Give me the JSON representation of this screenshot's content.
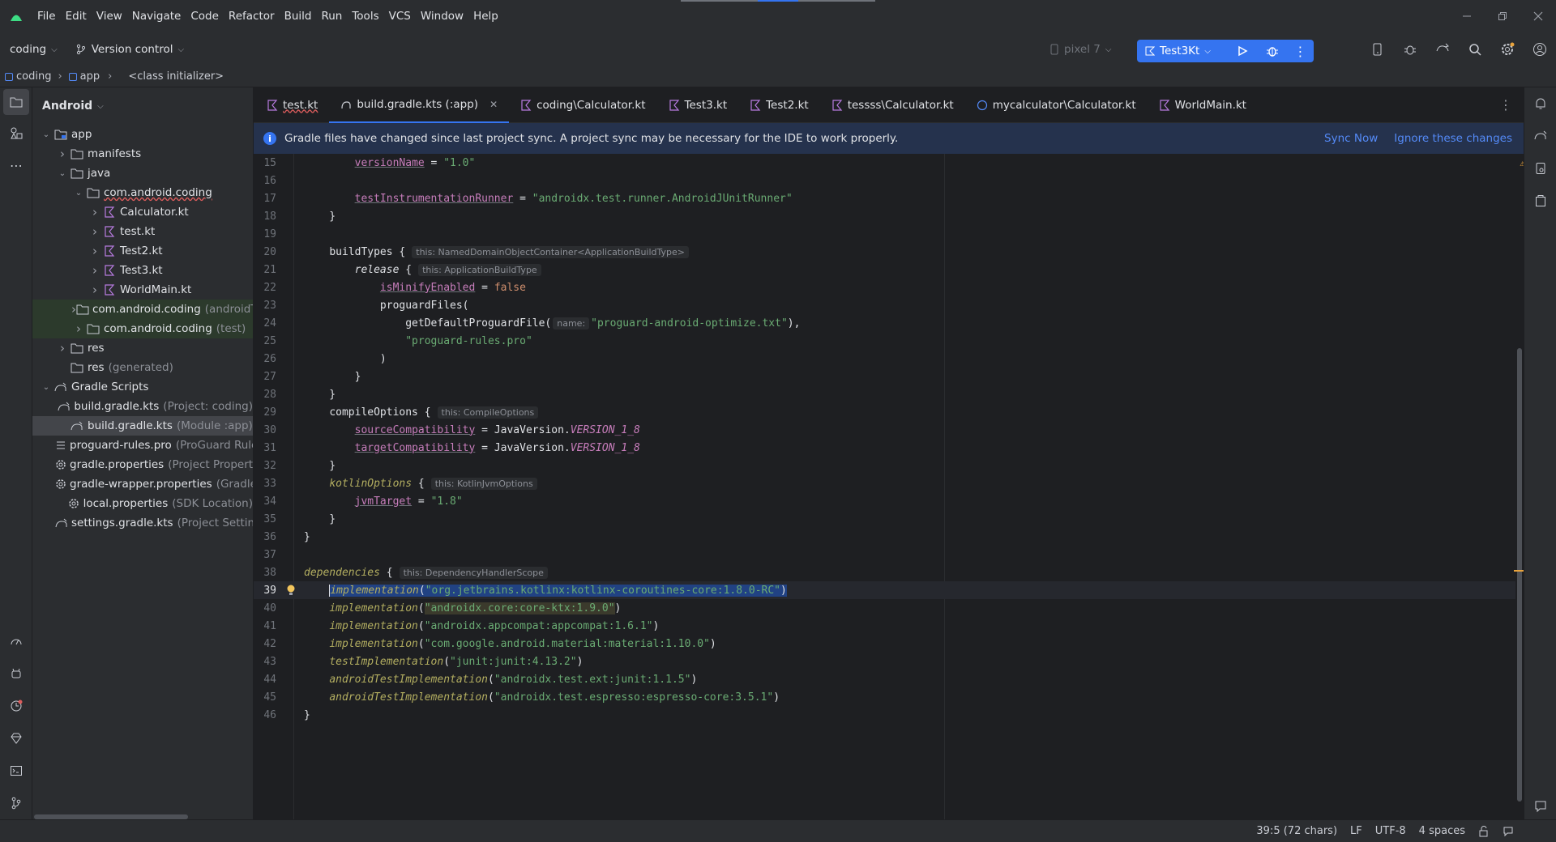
{
  "menu": [
    "File",
    "Edit",
    "View",
    "Navigate",
    "Code",
    "Refactor",
    "Build",
    "Run",
    "Tools",
    "VCS",
    "Window",
    "Help"
  ],
  "toolbar": {
    "project_name": "coding",
    "vcs_label": "Version control",
    "device": "pixel 7",
    "run_config": "Test3Kt"
  },
  "breadcrumb": [
    "coding",
    "app",
    "<class initializer>"
  ],
  "project_panel": {
    "title": "Android",
    "tree": [
      {
        "label": "app",
        "hint": ""
      },
      {
        "label": "manifests",
        "hint": ""
      },
      {
        "label": "java",
        "hint": ""
      },
      {
        "label": "com.android.coding",
        "hint": ""
      },
      {
        "label": "Calculator.kt",
        "hint": ""
      },
      {
        "label": "test.kt",
        "hint": ""
      },
      {
        "label": "Test2.kt",
        "hint": ""
      },
      {
        "label": "Test3.kt",
        "hint": ""
      },
      {
        "label": "WorldMain.kt",
        "hint": ""
      },
      {
        "label": "com.android.coding",
        "hint": "(androidTest)"
      },
      {
        "label": "com.android.coding",
        "hint": "(test)"
      },
      {
        "label": "res",
        "hint": ""
      },
      {
        "label": "res",
        "hint": "(generated)"
      },
      {
        "label": "Gradle Scripts",
        "hint": ""
      },
      {
        "label": "build.gradle.kts",
        "hint": "(Project: coding)"
      },
      {
        "label": "build.gradle.kts",
        "hint": "(Module :app)"
      },
      {
        "label": "proguard-rules.pro",
        "hint": "(ProGuard Rules for \":app\")"
      },
      {
        "label": "gradle.properties",
        "hint": "(Project Properties)"
      },
      {
        "label": "gradle-wrapper.properties",
        "hint": "(Gradle Version)"
      },
      {
        "label": "local.properties",
        "hint": "(SDK Location)"
      },
      {
        "label": "settings.gradle.kts",
        "hint": "(Project Settings)"
      }
    ]
  },
  "tabs": [
    "test.kt",
    "build.gradle.kts (:app)",
    "coding\\Calculator.kt",
    "Test3.kt",
    "Test2.kt",
    "tessss\\Calculator.kt",
    "mycalculator\\Calculator.kt",
    "WorldMain.kt"
  ],
  "banner": {
    "message": "Gradle files have changed since last project sync. A project sync may be necessary for the IDE to work properly.",
    "sync_now": "Sync Now",
    "ignore": "Ignore these changes"
  },
  "code": {
    "line_numbers": [
      "15",
      "16",
      "17",
      "18",
      "19",
      "20",
      "21",
      "22",
      "23",
      "24",
      "25",
      "26",
      "27",
      "28",
      "29",
      "30",
      "31",
      "32",
      "33",
      "34",
      "35",
      "36",
      "37",
      "38",
      "39",
      "40",
      "41",
      "42",
      "43",
      "44",
      "45",
      "46"
    ],
    "l15_prop": "versionName",
    "l15_val": "\"1.0\"",
    "l17_prop": "testInstrumentationRunner",
    "l17_val": "\"androidx.test.runner.AndroidJUnitRunner\"",
    "l20_fn": "buildTypes",
    "l20_hint": "this: NamedDomainObjectContainer<ApplicationBuildType>",
    "l21_fn": "release",
    "l21_hint": "this: ApplicationBuildType",
    "l22_prop": "isMinifyEnabled",
    "l22_val": "false",
    "l23_fn": "proguardFiles(",
    "l24_fn": "getDefaultProguardFile(",
    "l24_hint": "name:",
    "l24_val": "\"proguard-android-optimize.txt\"",
    "l25_val": "\"proguard-rules.pro\"",
    "l29_fn": "compileOptions",
    "l29_hint": "this: CompileOptions",
    "l30_prop": "sourceCompatibility",
    "l30_cls": "JavaVersion.",
    "l30_val": "VERSION_1_8",
    "l31_prop": "targetCompatibility",
    "l31_cls": "JavaVersion.",
    "l31_val": "VERSION_1_8",
    "l33_fn": "kotlinOptions",
    "l33_hint": "this: KotlinJvmOptions",
    "l34_prop": "jvmTarget",
    "l34_val": "\"1.8\"",
    "l38_fn": "dependencies",
    "l38_hint": "this: DependencyHandlerScope",
    "l39_fn": "implementation",
    "l39_val": "\"org.jetbrains.kotlinx:kotlinx-coroutines-core:1.8.0-RC\"",
    "l40_fn": "implementation",
    "l40_val": "\"androidx.core:core-ktx:1.9.0\"",
    "l41_fn": "implementation",
    "l41_val": "\"androidx.appcompat:appcompat:1.6.1\"",
    "l42_fn": "implementation",
    "l42_val": "\"com.google.android.material:material:1.10.0\"",
    "l43_fn": "testImplementation",
    "l43_val": "\"junit:junit:4.13.2\"",
    "l44_fn": "androidTestImplementation",
    "l44_val": "\"androidx.test.ext:junit:1.1.5\"",
    "l45_fn": "androidTestImplementation",
    "l45_val": "\"androidx.test.espresso:espresso-core:3.5.1\""
  },
  "status": {
    "position": "39:5 (72 chars)",
    "line_ending": "LF",
    "encoding": "UTF-8",
    "indent": "4 spaces"
  },
  "colors": {
    "accent": "#3574f0",
    "bg": "#1e1f22",
    "panel": "#2b2d30",
    "string": "#6aab73",
    "keyword": "#cf8e6d"
  }
}
